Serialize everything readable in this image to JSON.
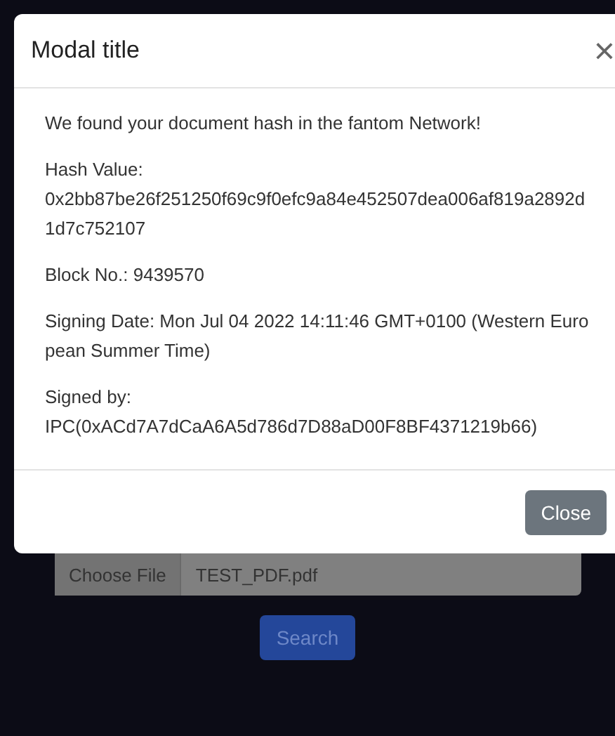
{
  "modal": {
    "title": "Modal title",
    "close_icon": "×",
    "paragraphs": [
      {
        "label": "We found your document hash in the fantom Network!"
      },
      {
        "label": "Hash Value:",
        "value": "0x2bb87be26f251250f69c9f0efc9a84e452507dea006af819a2892d1d7c752107"
      },
      {
        "label": "Block No.: 9439570"
      },
      {
        "label": "Signing Date: Mon Jul 04 2022 14:11:46 GMT+0100 (Western European Summer Time)"
      },
      {
        "label": "Signed by:",
        "value": "IPC(0xACd7A7dCaA6A5d786d7D88aD00F8BF4371219b66)"
      }
    ],
    "footer_button": "Close"
  },
  "file_input": {
    "button": "Choose File",
    "value": "TEST_PDF.pdf"
  },
  "search_button": "Search"
}
